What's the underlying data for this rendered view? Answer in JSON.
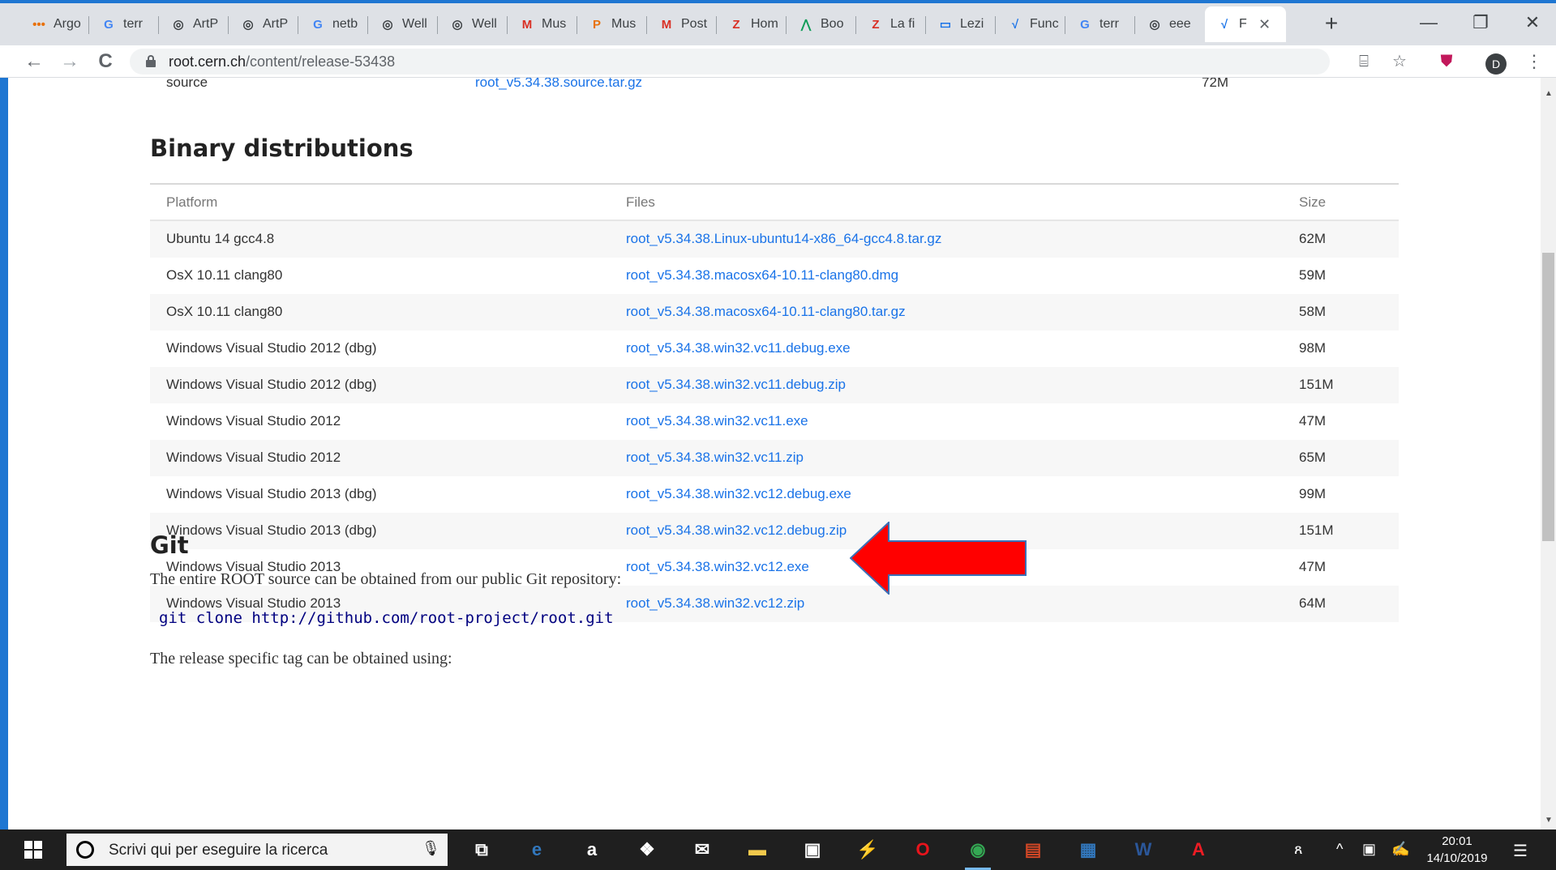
{
  "browser": {
    "tabs": [
      {
        "label": "Argo",
        "icon": "argo-icon",
        "icon_glyph": "•••",
        "color": "#e8710a"
      },
      {
        "label": "terr",
        "icon": "google-icon",
        "icon_glyph": "G",
        "color": "#4285f4"
      },
      {
        "label": "ArtP",
        "icon": "globe-icon",
        "icon_glyph": "◎",
        "color": "#3c4043"
      },
      {
        "label": "ArtP",
        "icon": "globe-icon",
        "icon_glyph": "◎",
        "color": "#3c4043"
      },
      {
        "label": "netb",
        "icon": "google-icon",
        "icon_glyph": "G",
        "color": "#4285f4"
      },
      {
        "label": "Well",
        "icon": "globe-icon",
        "icon_glyph": "◎",
        "color": "#3c4043"
      },
      {
        "label": "Well",
        "icon": "globe-icon",
        "icon_glyph": "◎",
        "color": "#3c4043"
      },
      {
        "label": "Mus",
        "icon": "gmail-icon",
        "icon_glyph": "M",
        "color": "#d93025"
      },
      {
        "label": "Mus",
        "icon": "p-icon",
        "icon_glyph": "P",
        "color": "#e8710a"
      },
      {
        "label": "Post",
        "icon": "gmail-icon",
        "icon_glyph": "M",
        "color": "#d93025"
      },
      {
        "label": "Hom",
        "icon": "z-icon",
        "icon_glyph": "Z",
        "color": "#d93025"
      },
      {
        "label": "Boo",
        "icon": "mountain-icon",
        "icon_glyph": "⋀",
        "color": "#0f9d58"
      },
      {
        "label": "La fi",
        "icon": "z-icon",
        "icon_glyph": "Z",
        "color": "#d93025"
      },
      {
        "label": "Lezi",
        "icon": "lecture-icon",
        "icon_glyph": "▭",
        "color": "#1a73e8"
      },
      {
        "label": "Func",
        "icon": "wave-icon",
        "icon_glyph": "√",
        "color": "#1a73e8"
      },
      {
        "label": "terr",
        "icon": "google-icon",
        "icon_glyph": "G",
        "color": "#4285f4"
      },
      {
        "label": "eee",
        "icon": "globe-icon",
        "icon_glyph": "◎",
        "color": "#3c4043"
      },
      {
        "label": "F",
        "icon": "root-icon",
        "icon_glyph": "√",
        "color": "#1a73e8",
        "active": true
      }
    ],
    "new_tab": "+",
    "minimize": "—",
    "restore": "❐",
    "close": "✕",
    "close_tab": "✕",
    "back": "←",
    "forward": "→",
    "reload": "C",
    "url_host": "root.cern.ch",
    "url_path": "/content/release-53438",
    "translate_icon": "⌸",
    "star_icon": "☆",
    "pocket_icon": "⛊",
    "profile_initial": "D",
    "menu_icon": "⋮"
  },
  "page": {
    "previous_row": {
      "platform": "source",
      "file": "root_v5.34.38.source.tar.gz",
      "size": "72M"
    },
    "binary_heading": "Binary distributions",
    "table": {
      "headers": [
        "Platform",
        "Files",
        "Size"
      ],
      "rows": [
        {
          "platform": "Ubuntu 14 gcc4.8",
          "file": "root_v5.34.38.Linux-ubuntu14-x86_64-gcc4.8.tar.gz",
          "size": "62M"
        },
        {
          "platform": "OsX 10.11 clang80",
          "file": "root_v5.34.38.macosx64-10.11-clang80.dmg",
          "size": "59M"
        },
        {
          "platform": "OsX 10.11 clang80",
          "file": "root_v5.34.38.macosx64-10.11-clang80.tar.gz",
          "size": "58M"
        },
        {
          "platform": "Windows Visual Studio 2012 (dbg)",
          "file": "root_v5.34.38.win32.vc11.debug.exe",
          "size": "98M"
        },
        {
          "platform": "Windows Visual Studio 2012 (dbg)",
          "file": "root_v5.34.38.win32.vc11.debug.zip",
          "size": "151M"
        },
        {
          "platform": "Windows Visual Studio 2012",
          "file": "root_v5.34.38.win32.vc11.exe",
          "size": "47M"
        },
        {
          "platform": "Windows Visual Studio 2012",
          "file": "root_v5.34.38.win32.vc11.zip",
          "size": "65M"
        },
        {
          "platform": "Windows Visual Studio 2013 (dbg)",
          "file": "root_v5.34.38.win32.vc12.debug.exe",
          "size": "99M"
        },
        {
          "platform": "Windows Visual Studio 2013 (dbg)",
          "file": "root_v5.34.38.win32.vc12.debug.zip",
          "size": "151M"
        },
        {
          "platform": "Windows Visual Studio 2013",
          "file": "root_v5.34.38.win32.vc12.exe",
          "size": "47M"
        },
        {
          "platform": "Windows Visual Studio 2013",
          "file": "root_v5.34.38.win32.vc12.zip",
          "size": "64M"
        }
      ]
    },
    "arrow_color": "#ff0000",
    "git_heading": "Git",
    "git_text": "The entire ROOT source can be obtained from our public Git repository:",
    "git_command": "git clone http://github.com/root-project/root.git",
    "tag_text": "The release specific tag can be obtained using:"
  },
  "taskbar": {
    "search_placeholder": "Scrivi qui per eseguire la ricerca",
    "apps": [
      {
        "name": "task-view-icon",
        "glyph": "⧉",
        "color": "#ffffff"
      },
      {
        "name": "edge-icon",
        "glyph": "e",
        "color": "#3277bc"
      },
      {
        "name": "amazon-icon",
        "glyph": "a",
        "color": "#ffffff"
      },
      {
        "name": "dropbox-icon",
        "glyph": "❖",
        "color": "#ffffff"
      },
      {
        "name": "mail-icon",
        "glyph": "✉",
        "color": "#ffffff"
      },
      {
        "name": "file-explorer-icon",
        "glyph": "▬",
        "color": "#f2c94c"
      },
      {
        "name": "store-icon",
        "glyph": "▣",
        "color": "#ffffff"
      },
      {
        "name": "visual-studio-icon",
        "glyph": "⚡",
        "color": "#3277bc"
      },
      {
        "name": "opera-icon",
        "glyph": "O",
        "color": "#e8141c"
      },
      {
        "name": "chrome-icon",
        "glyph": "◉",
        "color": "#34a853",
        "active": true
      },
      {
        "name": "powerpoint-icon",
        "glyph": "▤",
        "color": "#d24726"
      },
      {
        "name": "window-app-icon",
        "glyph": "▦",
        "color": "#3277bc"
      },
      {
        "name": "word-icon",
        "glyph": "W",
        "color": "#2b579a"
      },
      {
        "name": "acrobat-icon",
        "glyph": "A",
        "color": "#ed1c24"
      }
    ],
    "tray_people": "ጸ",
    "tray_chevron": "^",
    "tray_network": "▣",
    "tray_pen": "✍",
    "time": "20:01",
    "date": "14/10/2019",
    "notifications_icon": "☰"
  }
}
